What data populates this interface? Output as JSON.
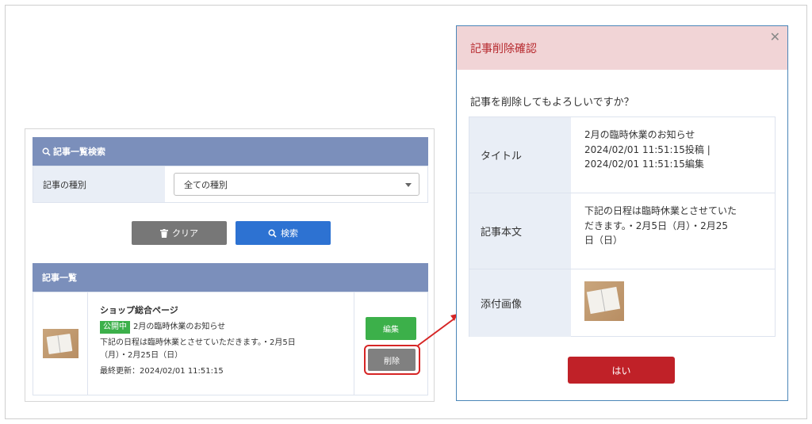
{
  "search_panel": {
    "header": "記事一覧検索",
    "type_label": "記事の種別",
    "type_value": "全ての種別",
    "clear_label": "クリア",
    "search_label": "検索"
  },
  "list_panel": {
    "header": "記事一覧",
    "items": [
      {
        "shop": "ショップ総合ページ",
        "status": "公開中",
        "title": "2月の臨時休業のお知らせ",
        "body_line1": "下記の日程は臨時休業とさせていただきます。・2月5日",
        "body_line2": "（月）・2月25日（日）",
        "updated": "最終更新：2024/02/01 11:51:15",
        "edit_label": "編集",
        "delete_label": "削除"
      }
    ]
  },
  "modal": {
    "title": "記事削除確認",
    "close_icon": "close-icon",
    "question": "記事を削除してもよろしいですか？",
    "rows": [
      {
        "label": "タイトル",
        "line1": "2月の臨時休業のお知らせ",
        "line2": "2024/02/01 11:51:15投稿 |",
        "line3": "2024/02/01 11:51:15編集"
      },
      {
        "label": "記事本文",
        "line1": "下記の日程は臨時休業とさせていた",
        "line2": "だきます。・2月5日（月）・2月25",
        "line3": "日（日）"
      },
      {
        "label": "添付画像"
      }
    ],
    "confirm_label": "はい"
  },
  "colors": {
    "panel_header": "#7b8fbb",
    "primary_blue": "#2d72d2",
    "success_green": "#3cb04a",
    "danger_red": "#c02128",
    "highlight_red": "#d62525"
  }
}
